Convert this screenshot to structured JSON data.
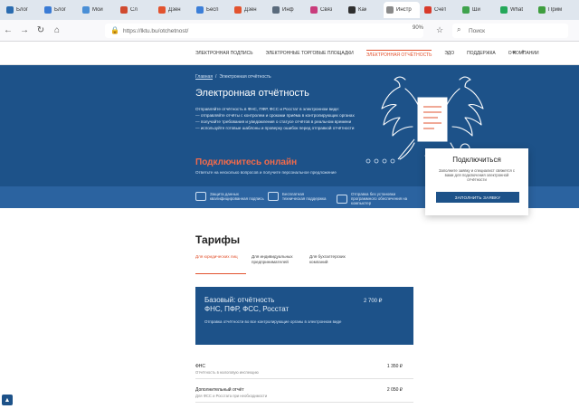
{
  "browser": {
    "tabs": [
      {
        "label": "Блог",
        "color": "#2b6cb0"
      },
      {
        "label": "Блог",
        "color": "#3a7bd5"
      },
      {
        "label": "Мой",
        "color": "#4a8fd6"
      },
      {
        "label": "Сл",
        "color": "#d04a2f"
      },
      {
        "label": "Дзен",
        "color": "#e2532f"
      },
      {
        "label": "Бесп",
        "color": "#3c7fd8"
      },
      {
        "label": "Дзен",
        "color": "#e2532f"
      },
      {
        "label": "Инф",
        "color": "#5a6b7c"
      },
      {
        "label": "Связ",
        "color": "#c93c7c"
      },
      {
        "label": "Как",
        "color": "#2f2f2f"
      },
      {
        "label": "Инстр",
        "color": "#8a8a8a"
      },
      {
        "label": "Счёт",
        "color": "#d83a2a"
      },
      {
        "label": "Ши",
        "color": "#3fa34d"
      },
      {
        "label": "What",
        "color": "#25a85a"
      },
      {
        "label": "Прим",
        "color": "#3f9e3f"
      }
    ],
    "url": "https://lktu.bu/otchetnost/",
    "zoom": "90%",
    "search_placeholder": "Поиск"
  },
  "site": {
    "nav": [
      {
        "label": "ЭЛЕКТРОННАЯ ПОДПИСЬ",
        "active": false
      },
      {
        "label": "ЭЛЕКТРОННЫЕ ТОРГОВЫЕ ПЛОЩАДКИ",
        "active": false
      },
      {
        "label": "ЭЛЕКТРОННАЯ ОТЧЁТНОСТЬ",
        "active": true
      },
      {
        "label": "ЭДО",
        "active": false
      },
      {
        "label": "ПОДДЕРЖКА",
        "active": false
      },
      {
        "label": "О КОМПАНИИ",
        "active": false
      }
    ]
  },
  "hero": {
    "breadcrumbs": [
      "Главная",
      "Электронная отчётность"
    ],
    "title": "Электронная отчётность",
    "lines": [
      "Отправляйте отчётность в ФНС, ПФР, ФСС и Росстат в электронном виде:",
      "— отправляйте отчёты с контролем и сроками приёма в контролирующих органах",
      "— получайте требования и уведомления о статусе отчётов в реальном времени",
      "— используйте готовые шаблоны и проверку ошибок перед отправкой отчётности"
    ],
    "connect_title": "Подключитесь онлайн",
    "connect_sub": "Ответьте на несколько вопросов и получите персональное предложение"
  },
  "features": [
    {
      "label": "Защита данных",
      "sub": "квалифицированная подпись"
    },
    {
      "label": "Бесплатная",
      "sub": "техническая поддержка"
    },
    {
      "label": "Отправка без установки",
      "sub": "программного обеспечения на компьютер"
    }
  ],
  "card": {
    "title": "Подключиться",
    "desc": "Заполните заявку и специалист свяжется с вами для подключения электронной отчётности",
    "button": "ЗАПОЛНИТЬ ЗАЯВКУ"
  },
  "tariffs": {
    "title": "Тарифы",
    "tabs": [
      {
        "label": "Для юридических лиц",
        "active": true
      },
      {
        "label": "Для индивидуальных предпринимателей",
        "active": false
      },
      {
        "label": "Для бухгалтерских компаний",
        "active": false
      }
    ],
    "plan": {
      "name_line1": "Базовый: отчётность",
      "name_line2": "ФНС, ПФР, ФСС, Росстат",
      "price": "2 700 ₽",
      "desc": "Отправка отчётности во все контролирующие органы в электронном виде"
    },
    "rows": [
      {
        "title": "ФНС",
        "sub": "Отчётность в налоговую инспекцию",
        "price": "1 350 ₽"
      },
      {
        "title": "Дополнительный отчёт",
        "sub": "Для ФСС и Росстата при необходимости",
        "price": "2 050 ₽"
      }
    ]
  },
  "scroll_top": "▲",
  "colors": {
    "primary": "#1d5289",
    "accent": "#e2532f",
    "strip": "#2b63a0"
  }
}
